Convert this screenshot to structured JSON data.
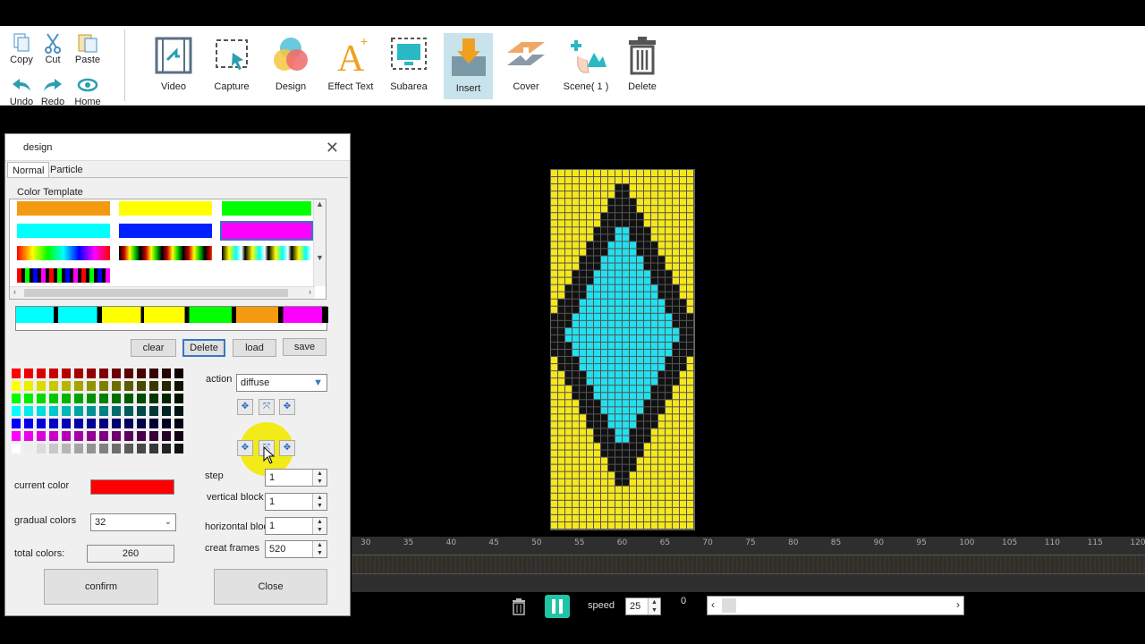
{
  "toolbar": {
    "small": [
      {
        "label": "Copy",
        "icon": "copy-icon"
      },
      {
        "label": "Cut",
        "icon": "cut-icon"
      },
      {
        "label": "Paste",
        "icon": "paste-icon"
      },
      {
        "label": "Undo",
        "icon": "undo-icon"
      },
      {
        "label": "Redo",
        "icon": "redo-icon"
      },
      {
        "label": "Home",
        "icon": "home-icon"
      }
    ],
    "big": [
      {
        "label": "Video",
        "icon": "video-icon"
      },
      {
        "label": "Capture",
        "icon": "capture-icon"
      },
      {
        "label": "Design",
        "icon": "design-icon"
      },
      {
        "label": "Effect Text",
        "icon": "effect-text-icon"
      },
      {
        "label": "Subarea",
        "icon": "subarea-icon"
      },
      {
        "label": "Insert",
        "icon": "insert-icon"
      },
      {
        "label": "Cover",
        "icon": "cover-icon"
      },
      {
        "label": "Scene( 1 )",
        "icon": "scene-icon"
      },
      {
        "label": "Delete",
        "icon": "trash-icon"
      }
    ],
    "active_item": "Insert"
  },
  "dialog": {
    "title": "design",
    "close_glyph": "✕",
    "tabs": [
      "Normal",
      "Particle"
    ],
    "active_tab": "Normal",
    "color_template_label": "Color Template",
    "buttons": {
      "clear": "clear",
      "delete": "Delete",
      "load": "load",
      "save": "save"
    },
    "action_label": "action",
    "action_value": "diffuse",
    "step_label": "step",
    "step_value": "1",
    "vertical_block_label": "vertical block",
    "vertical_block_value": "1",
    "horizontal_block_label": "horizontal bloc",
    "horizontal_block_value": "1",
    "creat_frames_label": "creat frames",
    "creat_frames_value": "520",
    "current_color_label": "current color",
    "current_color": "#ff0000",
    "gradual_colors_label": "gradual colors",
    "gradual_colors_value": "32",
    "total_colors_label": "total colors:",
    "total_colors_value": "260",
    "confirm_label": "confirm",
    "close_label": "Close"
  },
  "timeline": {
    "ticks": [
      "30",
      "35",
      "40",
      "45",
      "50",
      "55",
      "60",
      "65",
      "70",
      "75",
      "80",
      "85",
      "90",
      "95",
      "100",
      "105",
      "110",
      "115",
      "120"
    ]
  },
  "bottom": {
    "speed_label": "speed",
    "speed_value": "25",
    "frame_value": "0"
  },
  "colors": {
    "grid_bg": "#f5e71a",
    "grid_border": "#111111",
    "grid_cyan": "#22e0ef",
    "accent": "#3a76c4"
  }
}
